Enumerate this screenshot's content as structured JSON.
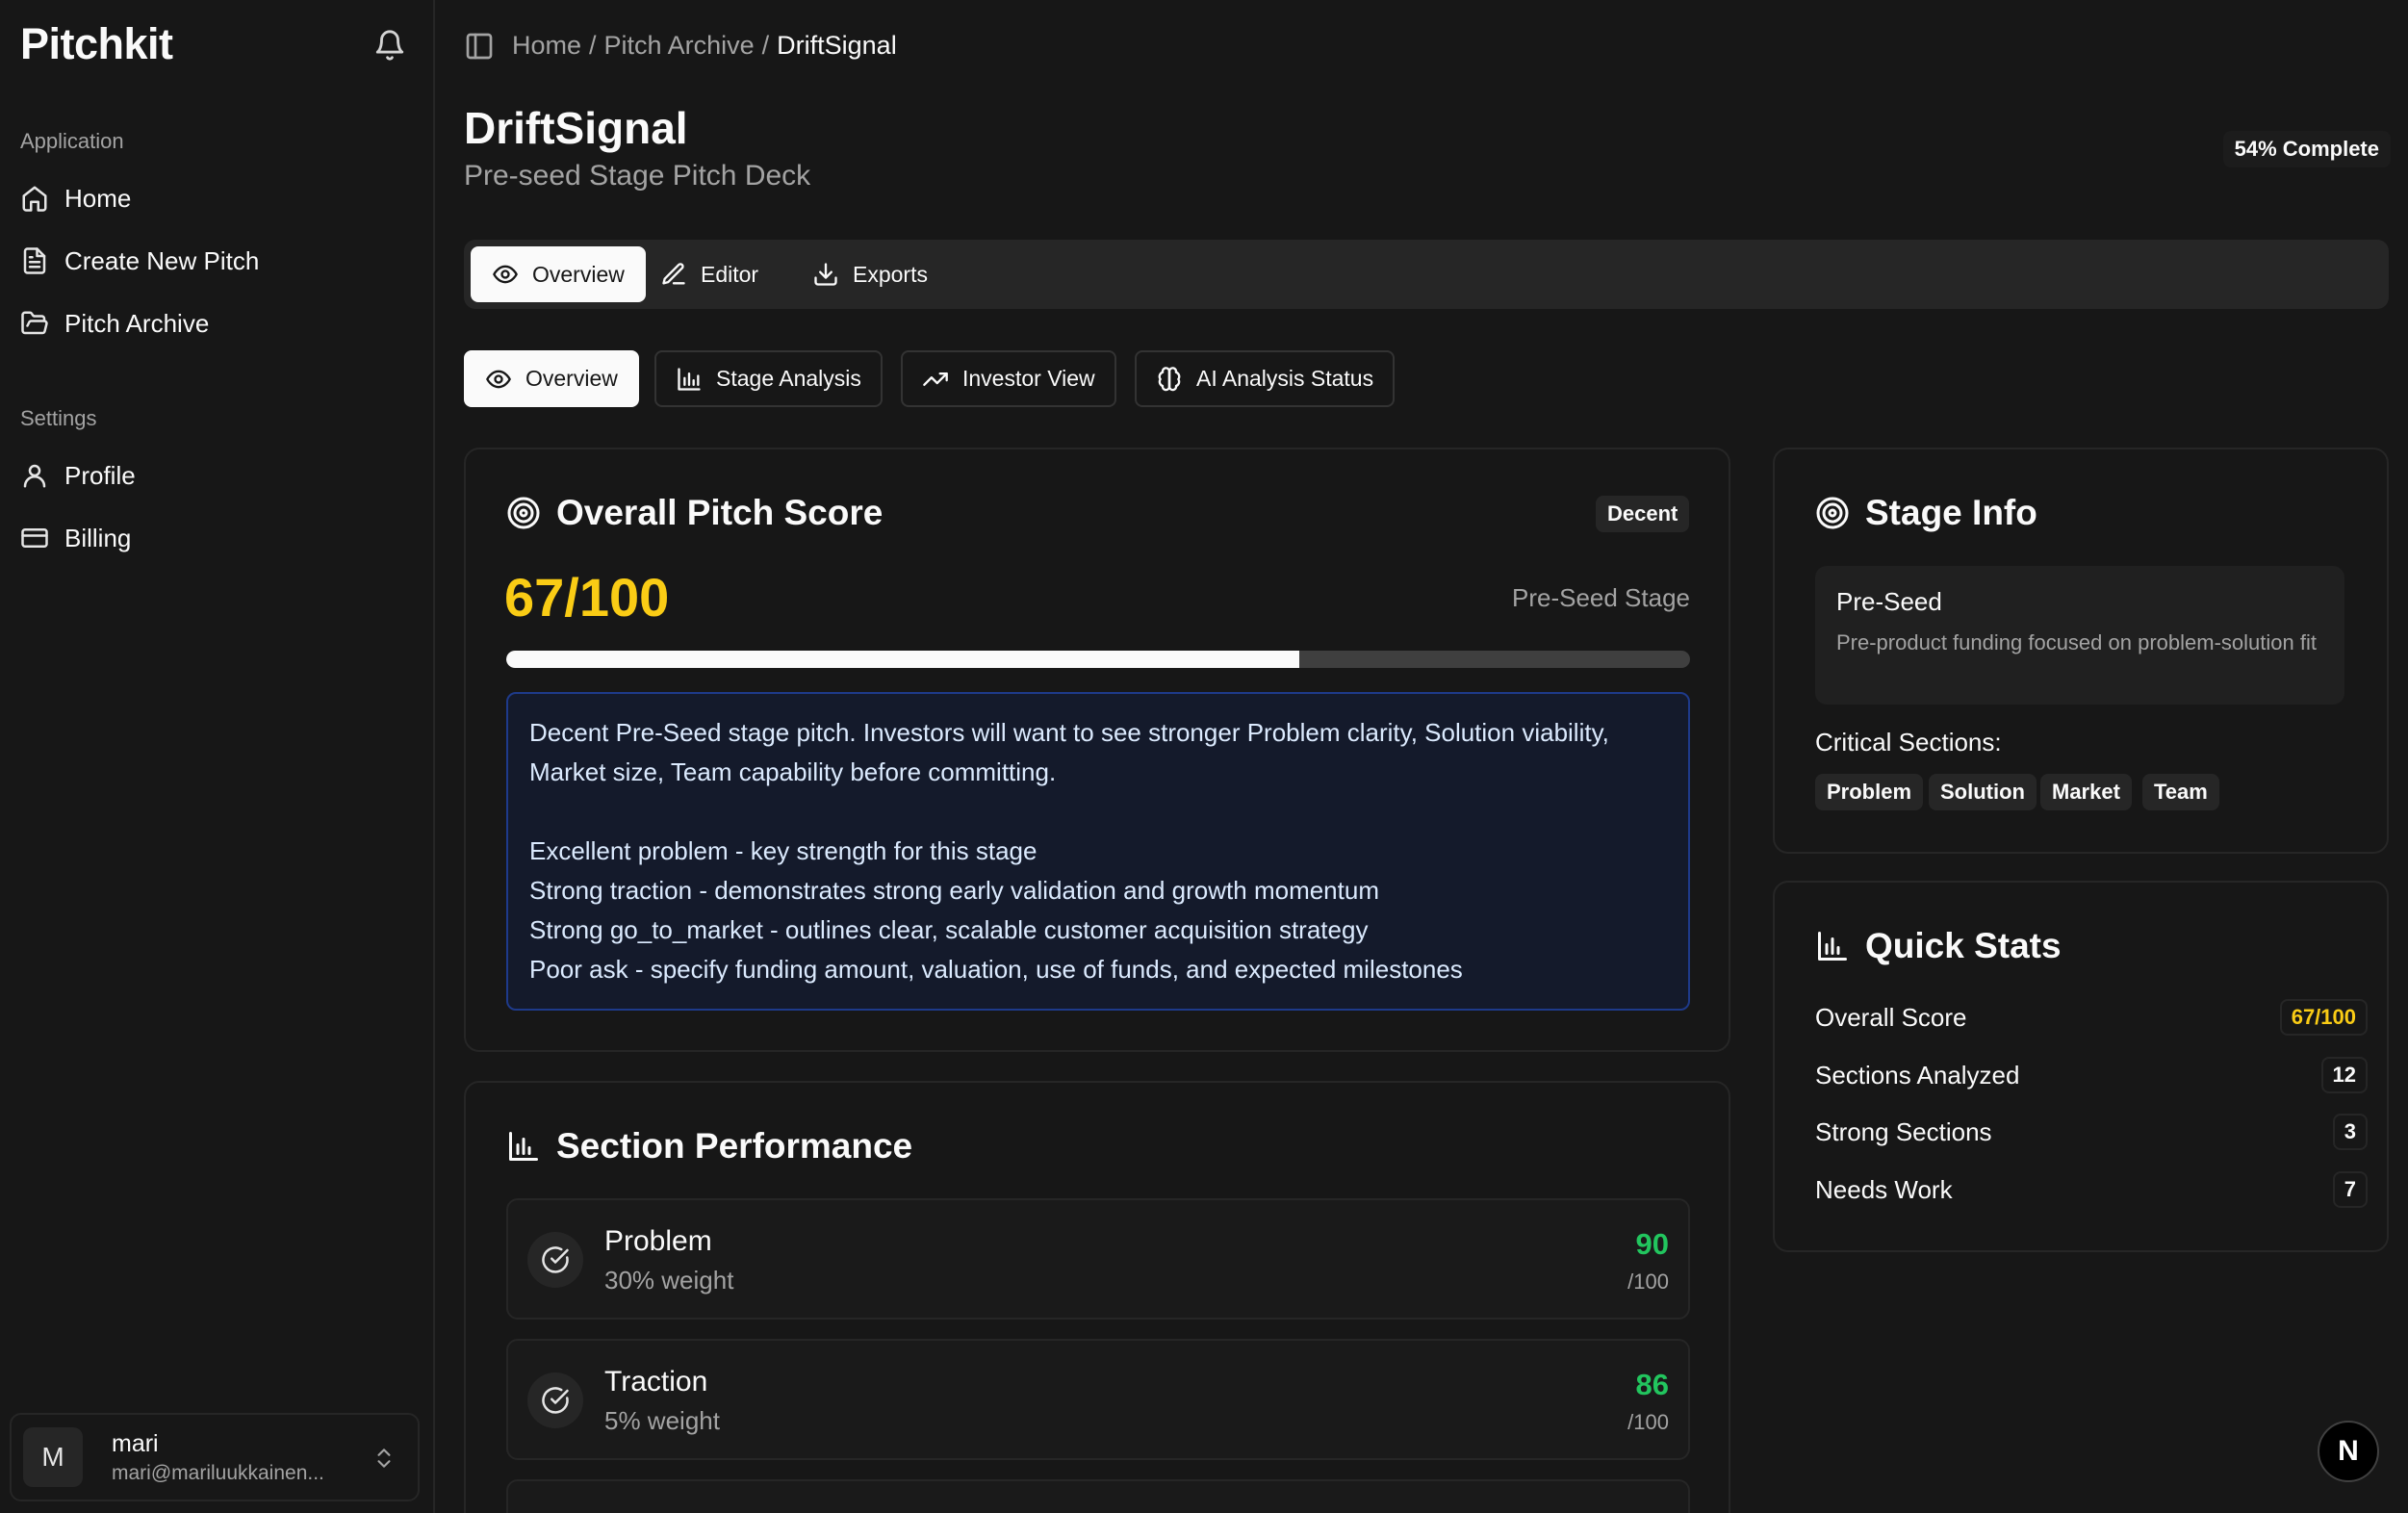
{
  "app": {
    "name": "Pitchkit"
  },
  "sidebar": {
    "application_label": "Application",
    "application_items": [
      {
        "label": "Home",
        "icon": "home-icon"
      },
      {
        "label": "Create New Pitch",
        "icon": "file-text-icon"
      },
      {
        "label": "Pitch Archive",
        "icon": "folder-open-icon"
      }
    ],
    "settings_label": "Settings",
    "settings_items": [
      {
        "label": "Profile",
        "icon": "user-icon"
      },
      {
        "label": "Billing",
        "icon": "credit-card-icon"
      }
    ],
    "user": {
      "initial": "M",
      "name": "mari",
      "email": "mari@mariluukkainen..."
    }
  },
  "header": {
    "breadcrumb": [
      "Home",
      "/",
      "Pitch Archive",
      "/",
      "DriftSignal"
    ],
    "title": "DriftSignal",
    "subtitle": "Pre-seed Stage Pitch Deck",
    "completion": "54% Complete"
  },
  "tabs": [
    {
      "label": "Overview",
      "icon": "eye-icon",
      "active": true
    },
    {
      "label": "Editor",
      "icon": "pen-icon",
      "active": false
    },
    {
      "label": "Exports",
      "icon": "download-icon",
      "active": false
    }
  ],
  "subtabs": [
    {
      "label": "Overview",
      "icon": "eye-icon",
      "active": true
    },
    {
      "label": "Stage Analysis",
      "icon": "bar-chart-icon",
      "active": false
    },
    {
      "label": "Investor View",
      "icon": "trending-up-icon",
      "active": false
    },
    {
      "label": "AI Analysis Status",
      "icon": "brain-icon",
      "active": false
    }
  ],
  "overall": {
    "title": "Overall Pitch Score",
    "rating": "Decent",
    "score": "67/100",
    "score_fraction": 0.67,
    "stage": "Pre-Seed Stage",
    "summary_lines": [
      "Decent Pre-Seed stage pitch. Investors will want to see stronger Problem clarity, Solution viability, Market size, Team capability before committing.",
      "",
      "Excellent problem - key strength for this stage",
      "Strong traction - demonstrates strong early validation and growth momentum",
      "Strong go_to_market - outlines clear, scalable customer acquisition strategy",
      "Poor ask - specify funding amount, valuation, use of funds, and expected milestones"
    ]
  },
  "section_performance": {
    "title": "Section Performance",
    "sections": [
      {
        "name": "Problem",
        "weight": "30% weight",
        "score": "90",
        "of": "/100"
      },
      {
        "name": "Traction",
        "weight": "5% weight",
        "score": "86",
        "of": "/100"
      }
    ]
  },
  "stage_info": {
    "title": "Stage Info",
    "stage_name": "Pre-Seed",
    "stage_desc": "Pre-product funding focused on problem-solution fit",
    "critical_label": "Critical Sections:",
    "critical_sections": [
      "Problem",
      "Solution",
      "Market",
      "Team"
    ]
  },
  "quick_stats": {
    "title": "Quick Stats",
    "items": [
      {
        "label": "Overall Score",
        "value": "67/100"
      },
      {
        "label": "Sections Analyzed",
        "value": "12"
      },
      {
        "label": "Strong Sections",
        "value": "3"
      },
      {
        "label": "Needs Work",
        "value": "7"
      }
    ]
  },
  "floating": {
    "label": "N"
  },
  "colors": {
    "accent": "#facc15",
    "success": "#22c55e",
    "summary_bg": "#141a2b",
    "summary_border": "#1e3a8a"
  }
}
